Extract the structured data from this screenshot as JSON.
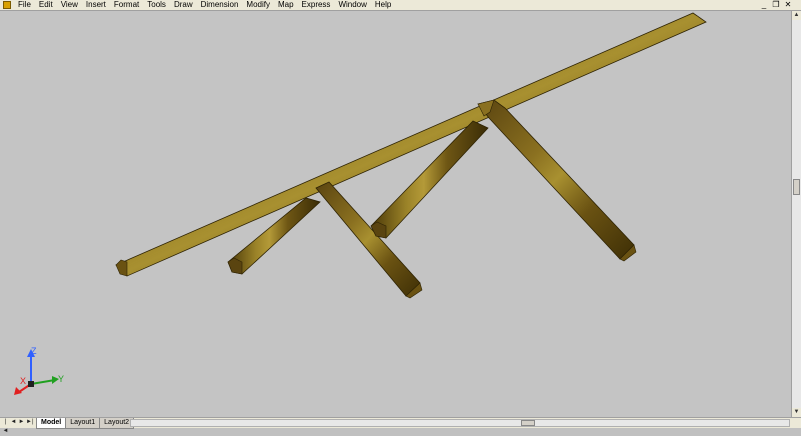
{
  "menu": {
    "app_icon": "autocad-app-icon",
    "items": [
      "File",
      "Edit",
      "View",
      "Insert",
      "Format",
      "Tools",
      "Draw",
      "Dimension",
      "Modify",
      "Map",
      "Express",
      "Window",
      "Help"
    ]
  },
  "window_controls": {
    "minimize": "_",
    "restore": "❐",
    "close": "✕"
  },
  "ucs": {
    "z_label": "Z",
    "x_label": "X",
    "y_label": "Y"
  },
  "tabs": {
    "items": [
      "Model",
      "Layout1",
      "Layout2"
    ],
    "active": "Model"
  },
  "nav_buttons": [
    "|◄",
    "◄",
    "►",
    "►|"
  ],
  "colors": {
    "viewport_bg": "#c4c4c4",
    "timber_dark": "#3e2f06",
    "timber_mid": "#7a6214",
    "timber_light": "#a89030",
    "ucs_z": "#3060ff",
    "ucs_x": "#e02020",
    "ucs_y": "#20a020"
  }
}
